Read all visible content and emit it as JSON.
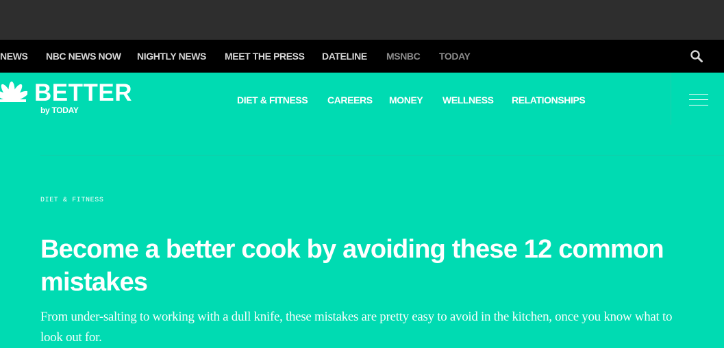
{
  "network_nav": {
    "items": [
      {
        "label": "NEWS"
      },
      {
        "label": "NBC NEWS NOW"
      },
      {
        "label": "NIGHTLY NEWS"
      },
      {
        "label": "MEET THE PRESS"
      },
      {
        "label": "DATELINE"
      },
      {
        "label": "MSNBC"
      },
      {
        "label": "TODAY"
      }
    ],
    "search_icon": "search-icon"
  },
  "header": {
    "logo_word": "BETTER",
    "logo_sub": "by TODAY",
    "logo_icon": "nbc-peacock-icon",
    "sections": [
      {
        "label": "DIET & FITNESS"
      },
      {
        "label": "CAREERS"
      },
      {
        "label": "MONEY"
      },
      {
        "label": "WELLNESS"
      },
      {
        "label": "RELATIONSHIPS"
      }
    ],
    "menu_icon": "hamburger-menu-icon"
  },
  "article": {
    "category": "DIET & FITNESS",
    "headline": "Become a better cook by avoiding these 12 common mistakes",
    "dek": "From under-salting to working with a dull knife, these mistakes are pretty easy to avoid in the kitchen, once you know what to look out for."
  },
  "colors": {
    "brand_background": "#00dbb2",
    "network_bar": "#000000",
    "ad_bar": "#2e2e2e"
  }
}
